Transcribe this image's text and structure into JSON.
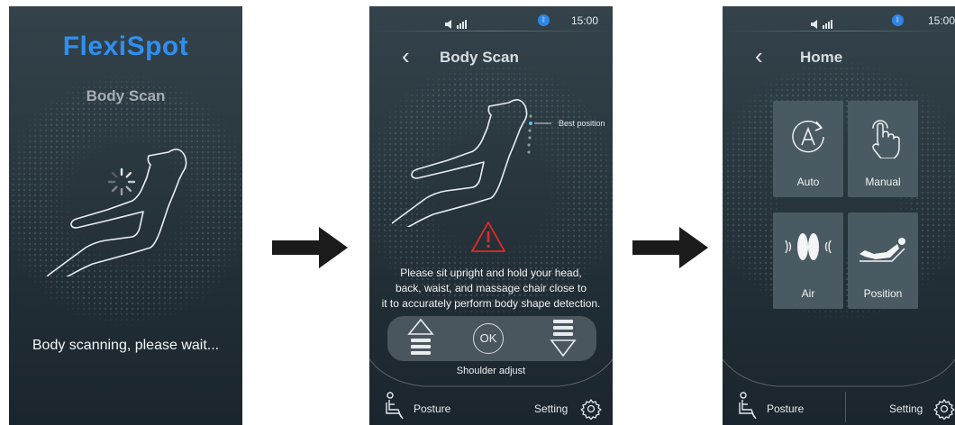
{
  "screen1": {
    "logo": "FlexiSpot",
    "title": "Body Scan",
    "status_message": "Body scanning, please wait..."
  },
  "screen2": {
    "status_bar": {
      "volume_icon": "volume-signal-icon",
      "bluetooth_icon": "bluetooth-icon",
      "time": "15:00"
    },
    "header_title": "Body Scan",
    "best_position_label": "Best position",
    "instruction_lines": [
      "Please sit upright and hold your head,",
      "back, waist, and massage chair close to",
      "it to accurately perform body shape detection."
    ],
    "ok_label": "OK",
    "shoulder_adjust_label": "Shoulder adjust",
    "nav": {
      "posture_label": "Posture",
      "setting_label": "Setting"
    }
  },
  "screen3": {
    "status_bar": {
      "volume_icon": "volume-signal-icon",
      "bluetooth_icon": "bluetooth-icon",
      "time": "15:00"
    },
    "header_title": "Home",
    "tiles": [
      {
        "label": "Auto",
        "icon": "auto-icon"
      },
      {
        "label": "Manual",
        "icon": "hand-touch-icon"
      },
      {
        "label": "Air",
        "icon": "air-icon"
      },
      {
        "label": "Position",
        "icon": "recline-position-icon"
      }
    ],
    "nav": {
      "posture_label": "Posture",
      "setting_label": "Setting"
    }
  },
  "colors": {
    "logo_blue": "#2f8ff0",
    "warning_red": "#e02a2a",
    "screen_bg": "#2a3840",
    "bluetooth_blue": "#2e86e6"
  }
}
